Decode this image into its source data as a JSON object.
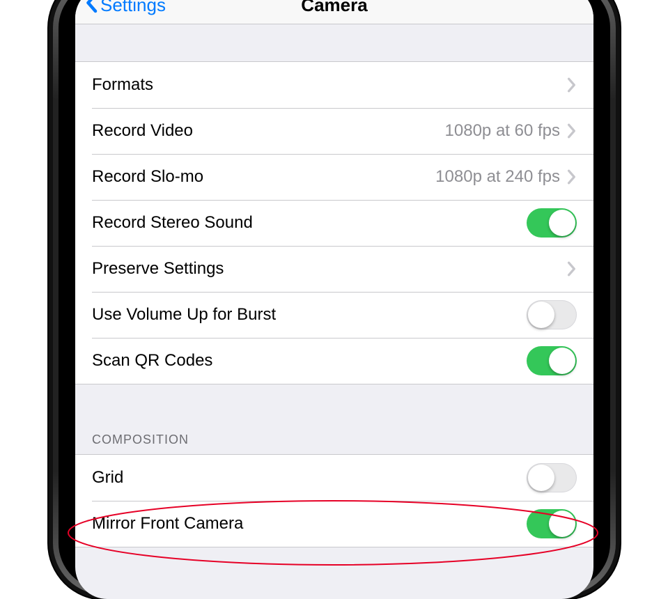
{
  "nav": {
    "back_label": "Settings",
    "title": "Camera"
  },
  "section1": {
    "rows": [
      {
        "label": "Formats",
        "type": "nav",
        "value": ""
      },
      {
        "label": "Record Video",
        "type": "nav",
        "value": "1080p at 60 fps"
      },
      {
        "label": "Record Slo-mo",
        "type": "nav",
        "value": "1080p at 240 fps"
      },
      {
        "label": "Record Stereo Sound",
        "type": "toggle",
        "on": true
      },
      {
        "label": "Preserve Settings",
        "type": "nav",
        "value": ""
      },
      {
        "label": "Use Volume Up for Burst",
        "type": "toggle",
        "on": false
      },
      {
        "label": "Scan QR Codes",
        "type": "toggle",
        "on": true
      }
    ]
  },
  "section2": {
    "header": "COMPOSITION",
    "rows": [
      {
        "label": "Grid",
        "type": "toggle",
        "on": false
      },
      {
        "label": "Mirror Front Camera",
        "type": "toggle",
        "on": true
      }
    ]
  },
  "colors": {
    "accent": "#007aff",
    "toggle_on": "#34c759",
    "annotation": "#e60026"
  }
}
